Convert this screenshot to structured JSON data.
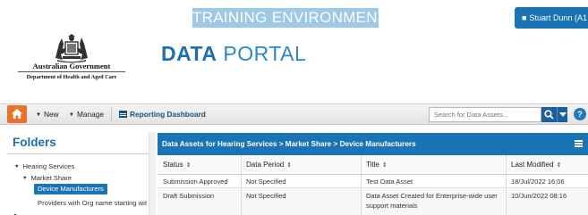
{
  "header": {
    "environment_banner": "TRAINING ENVIRONMENT",
    "user_button_label": "Stuart Dunn (A1",
    "government_name": "Australian Government",
    "department_name": "Department of Health and Aged Care",
    "portal_logo_bold": "DATA",
    "portal_logo_light": "PORTAL"
  },
  "navbar": {
    "home_icon": "home-icon",
    "new_label": "New",
    "manage_label": "Manage",
    "reporting_label": "Reporting Dashboard",
    "search_placeholder": "Search for Data Assets...",
    "help_label": "?"
  },
  "folders": {
    "title": "Folders",
    "items": [
      {
        "label": "Hearing Services",
        "level": 0,
        "expanded": true
      },
      {
        "label": "Market Share",
        "level": 1,
        "expanded": true
      },
      {
        "label": "Device Manufacturers",
        "level": 2,
        "selected": true
      },
      {
        "label": "Providers with Org name starting wit",
        "level": 2
      }
    ]
  },
  "table": {
    "title": "Data Assets for Hearing Services > Market Share > Device Manufacturers",
    "columns": [
      {
        "label": "Status",
        "sort": "⇕"
      },
      {
        "label": "Data Period",
        "sort": "⇕"
      },
      {
        "label": "Title",
        "sort": "⇕"
      },
      {
        "label": "Last Modified",
        "sort": "⇕"
      }
    ],
    "rows": [
      {
        "status": "Submission Approved",
        "period": "Not Specified",
        "title_line1": "Test Data Asset",
        "title_line2": "",
        "modified": "18/Jul/2022 16:06"
      },
      {
        "status": "Draft Submission",
        "period": "Not Specified",
        "title_line1": "Data Asset Created for Enterprise-wide user",
        "title_line2": "support materials",
        "modified": "10/Jun/2022 08:16"
      }
    ]
  },
  "colors": {
    "primary_blue": "#1a73b5",
    "banner_blue": "#9ec8e8",
    "home_orange": "#e8732e"
  }
}
